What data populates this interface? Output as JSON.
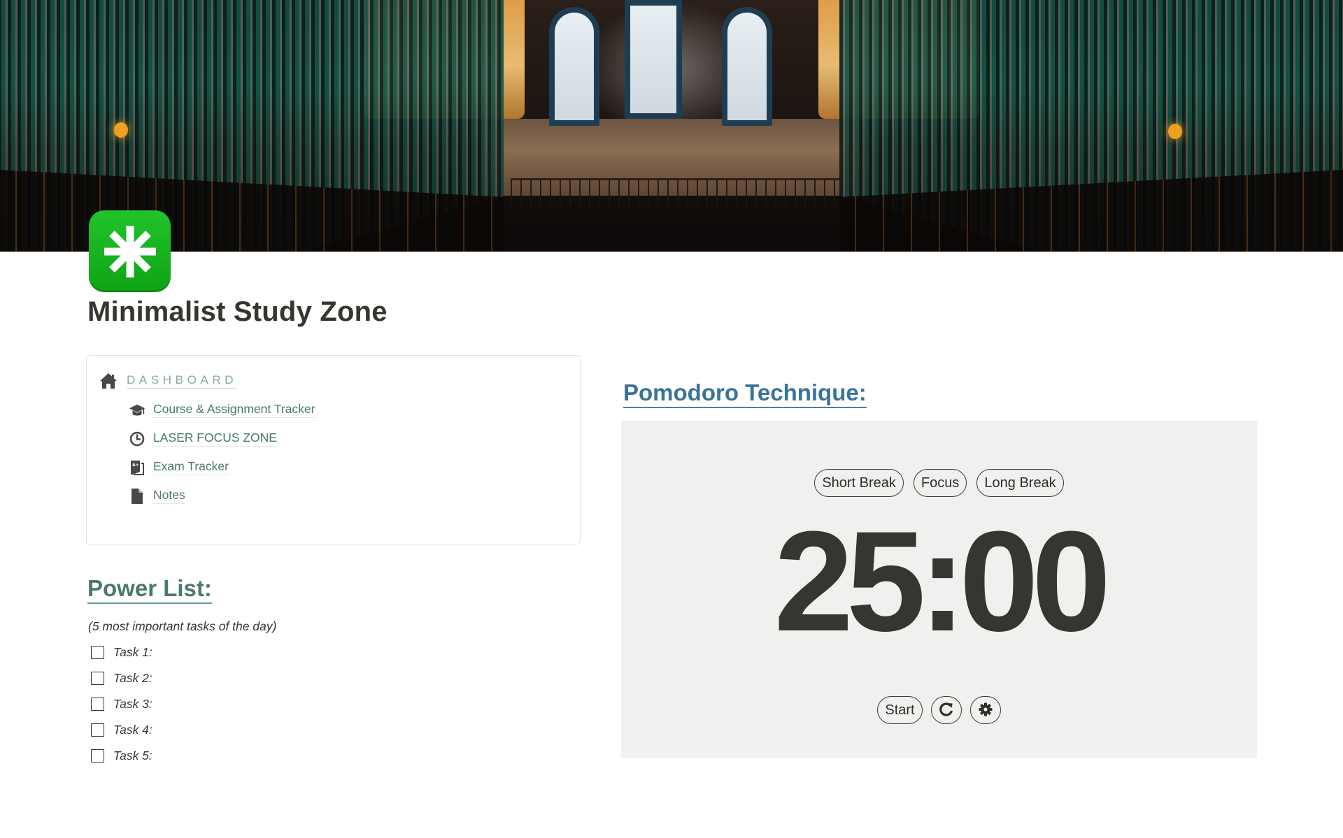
{
  "page": {
    "title": "Minimalist Study Zone",
    "icon": "eight-spoked-asterisk-icon",
    "cover": "library-bookshelves-photo"
  },
  "dashboard": {
    "title": "DASHBOARD",
    "icon": "home-icon",
    "items": [
      {
        "label": "Course & Assignment Tracker",
        "icon": "graduation-cap-icon"
      },
      {
        "label": "LASER FOCUS ZONE",
        "icon": "clock-icon"
      },
      {
        "label": "Exam Tracker",
        "icon": "grade-sheet-icon"
      },
      {
        "label": "Notes",
        "icon": "document-icon"
      }
    ]
  },
  "power_list": {
    "title": "Power List:",
    "subtitle": "(5 most important tasks of the day)",
    "tasks": [
      {
        "label": "Task 1:",
        "checked": false
      },
      {
        "label": "Task 2:",
        "checked": false
      },
      {
        "label": "Task 3:",
        "checked": false
      },
      {
        "label": "Task 4:",
        "checked": false
      },
      {
        "label": "Task 5:",
        "checked": false
      }
    ]
  },
  "pomodoro": {
    "title": "Pomodoro Technique:",
    "modes": [
      "Short Break",
      "Focus",
      "Long Break"
    ],
    "time": "25:00",
    "start_label": "Start",
    "reset_icon": "reset-icon",
    "settings_icon": "gear-icon"
  },
  "colors": {
    "dashboard_link": "#4a7a66",
    "dashboard_title": "#8aaa98",
    "power_title": "#4a7a66",
    "pomodoro_title": "#3a7399",
    "timer_panel_bg": "#f0f0ee",
    "page_icon_green": "#12b01b",
    "text": "#37352f"
  }
}
